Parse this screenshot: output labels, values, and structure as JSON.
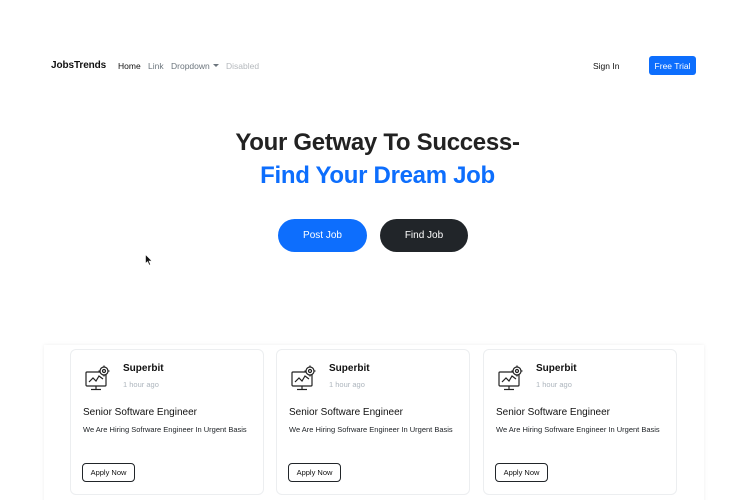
{
  "navbar": {
    "brand": "JobsTrends",
    "links": [
      {
        "label": "Home",
        "state": "active"
      },
      {
        "label": "Link",
        "state": "normal"
      },
      {
        "label": "Dropdown",
        "state": "dropdown"
      },
      {
        "label": "Disabled",
        "state": "disabled"
      }
    ],
    "sign_in": "Sign In",
    "free_trial": "Free Trial"
  },
  "hero": {
    "title_line1": "Your Getway To Success-",
    "title_line2": "Find Your Dream Job",
    "post_job": "Post Job",
    "find_job": "Find Job"
  },
  "jobs": [
    {
      "company": "Superbit",
      "posted": "1 hour ago",
      "title": "Senior Software Engineer",
      "description": "We Are Hiring Sofrware Engineer In Urgent Basis",
      "apply": "Apply Now",
      "icon": "computer-gear-icon"
    },
    {
      "company": "Superbit",
      "posted": "1 hour ago",
      "title": "Senior Software Engineer",
      "description": "We Are Hiring Sofrware Engineer In Urgent Basis",
      "apply": "Apply Now",
      "icon": "computer-gear-icon"
    },
    {
      "company": "Superbit",
      "posted": "1 hour ago",
      "title": "Senior Software Engineer",
      "description": "We Are Hiring Sofrware Engineer In Urgent Basis",
      "apply": "Apply Now",
      "icon": "computer-gear-icon"
    }
  ],
  "colors": {
    "primary": "#0d6efd",
    "dark": "#212529",
    "muted": "#6c757d"
  }
}
